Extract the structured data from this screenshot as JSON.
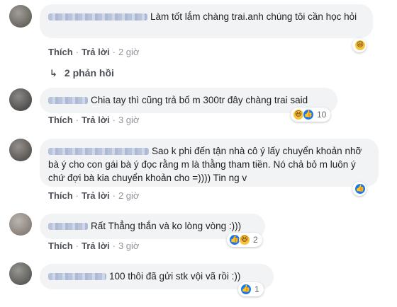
{
  "labels": {
    "like": "Thích",
    "reply": "Trả lời",
    "dot": "·"
  },
  "colors": {
    "bubble": "#f2f3f5",
    "link": "#4b4f56",
    "like_blue": "#1877f2",
    "haha_yellow": "#f7c33c"
  },
  "comments": [
    {
      "text": "Làm tốt lắm chàng trai.anh chúng tôi cần học hỏi",
      "time": "2 giờ",
      "reactions": [
        "haha"
      ],
      "count": ""
    },
    {
      "text": "Chia tay thì cũng trả bố m 300tr đây chàng trai said",
      "time": "3 giờ",
      "reactions": [
        "haha",
        "like"
      ],
      "count": "10"
    },
    {
      "text": "Sao k phi đến tận nhà cô ý lấy chuyển khoản nhỡ bà ý cho con gái bà ý đọc rằng m là thằng tham tiền. Nó chả bỏ m luôn ý chứ đợi bà kia chuyển khoản cho =)))) Tin ng v",
      "time": "2 giờ",
      "reactions": [
        "like"
      ],
      "count": ""
    },
    {
      "text": "Rất Thẳng thắn và ko lòng vòng :)))",
      "time": "3 giờ",
      "reactions": [
        "like",
        "haha"
      ],
      "count": "2"
    },
    {
      "text": "100 thôi đã gửi stk vội vã rồi :))",
      "time": "",
      "reactions": [
        "like"
      ],
      "count": "1"
    }
  ],
  "replies_link": "2 phản hồi",
  "icons": {
    "replies": "reply-arrow-icon",
    "haha": "haha-reaction-icon",
    "like": "like-reaction-icon"
  }
}
